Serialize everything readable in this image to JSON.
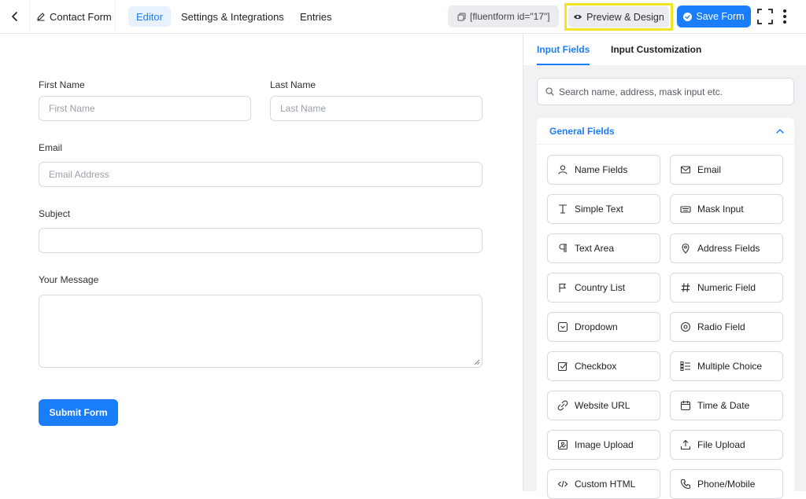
{
  "topbar": {
    "form_title": "Contact Form",
    "tabs": [
      "Editor",
      "Settings & Integrations",
      "Entries"
    ],
    "shortcode": "[fluentform id=\"17\"]",
    "preview_label": "Preview & Design",
    "save_label": "Save Form"
  },
  "form": {
    "first_name": {
      "label": "First Name",
      "placeholder": "First Name"
    },
    "last_name": {
      "label": "Last Name",
      "placeholder": "Last Name"
    },
    "email": {
      "label": "Email",
      "placeholder": "Email Address"
    },
    "subject": {
      "label": "Subject",
      "placeholder": ""
    },
    "message": {
      "label": "Your Message"
    },
    "submit_label": "Submit Form"
  },
  "sidebar": {
    "tabs": [
      "Input Fields",
      "Input Customization"
    ],
    "search_placeholder": "Search name, address, mask input etc.",
    "group_title": "General Fields",
    "fields": [
      {
        "label": "Name Fields",
        "icon": "user-icon"
      },
      {
        "label": "Email",
        "icon": "envelope-icon"
      },
      {
        "label": "Simple Text",
        "icon": "text-cursor-icon"
      },
      {
        "label": "Mask Input",
        "icon": "keyboard-icon"
      },
      {
        "label": "Text Area",
        "icon": "paragraph-icon"
      },
      {
        "label": "Address Fields",
        "icon": "map-pin-icon"
      },
      {
        "label": "Country List",
        "icon": "flag-icon"
      },
      {
        "label": "Numeric Field",
        "icon": "hash-icon"
      },
      {
        "label": "Dropdown",
        "icon": "dropdown-icon"
      },
      {
        "label": "Radio Field",
        "icon": "radio-icon"
      },
      {
        "label": "Checkbox",
        "icon": "checkbox-icon"
      },
      {
        "label": "Multiple Choice",
        "icon": "list-icon"
      },
      {
        "label": "Website URL",
        "icon": "link-icon"
      },
      {
        "label": "Time & Date",
        "icon": "calendar-icon"
      },
      {
        "label": "Image Upload",
        "icon": "image-icon"
      },
      {
        "label": "File Upload",
        "icon": "upload-icon"
      },
      {
        "label": "Custom HTML",
        "icon": "code-icon"
      },
      {
        "label": "Phone/Mobile",
        "icon": "phone-icon"
      }
    ]
  },
  "colors": {
    "accent": "#1a7efb",
    "highlight": "#f2e325"
  }
}
